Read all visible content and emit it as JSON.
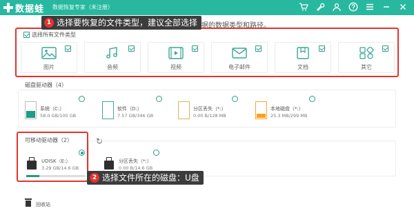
{
  "window": {
    "app_name": "数据蛙",
    "subtitle": "数据恢复专家（未注册）",
    "brand_color": "#28b8a0",
    "titlebar_icons": [
      "cart-icon",
      "wrench-icon",
      "user-icon",
      "help-icon",
      "menu-icon",
      "minimize-icon",
      "close-icon"
    ]
  },
  "description": "丢失数据的数据类型和路径。",
  "callouts": {
    "one": {
      "num": "1",
      "text": "选择要恢复的文件类型，建议全部选择"
    },
    "two": {
      "num": "2",
      "text": "选择文件所在的磁盘：U盘"
    }
  },
  "file_types": {
    "select_all_label": "选择所有文件类型",
    "items": [
      {
        "label": "图片",
        "icon": "image-icon",
        "checked": true
      },
      {
        "label": "音频",
        "icon": "audio-icon",
        "checked": true
      },
      {
        "label": "视频",
        "icon": "video-icon",
        "checked": true
      },
      {
        "label": "电子邮件",
        "icon": "email-icon",
        "checked": true
      },
      {
        "label": "文档",
        "icon": "document-icon",
        "checked": true
      },
      {
        "label": "其它",
        "icon": "other-icon",
        "checked": true
      }
    ]
  },
  "disks": {
    "section_label": "磁盘驱动器（4）",
    "items": [
      {
        "name": "系统（C:）",
        "size": "58.0 GB/100 GB",
        "icon": "system-drive-icon"
      },
      {
        "name": "软件（D:）",
        "size": "7.57 GB/346 GB",
        "icon": "drive-icon"
      },
      {
        "name": "分区丢失（*:）",
        "size": "0.00 B/128 MB",
        "icon": "lost-partition-icon"
      },
      {
        "name": "本地磁盘（*:）",
        "size": "25.3 MB/299 MB",
        "icon": "local-disk-icon"
      }
    ]
  },
  "removable": {
    "section_label": "可移动驱动器（2）",
    "items": [
      {
        "name": "UDISK（E:）",
        "size": "3.29 GB/14.6 GB",
        "selected": true,
        "used_fraction": 0.22
      },
      {
        "name": "分区丢失（*:）",
        "size": "0.00 B/14.6 GB",
        "selected": false
      }
    ]
  },
  "recycle_bin": {
    "label": "回收站"
  }
}
